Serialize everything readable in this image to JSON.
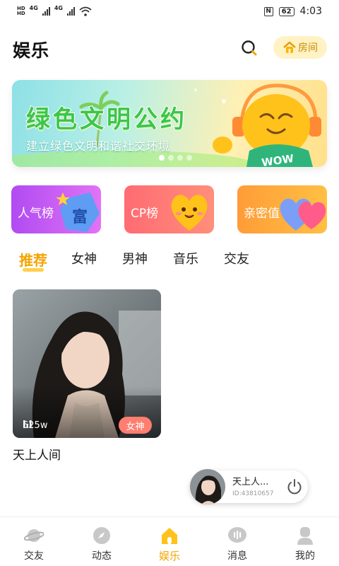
{
  "status_bar": {
    "network1": "4G",
    "network2": "4G",
    "nfc": "N",
    "battery": "62",
    "time": "4:03"
  },
  "header": {
    "title": "娱乐",
    "room_button": "房间"
  },
  "banner": {
    "title": "绿色文明公约",
    "subtitle": "建立绿色文明和谐社交环境",
    "art_text": "WOW",
    "active_dot": 1,
    "dot_count": 4
  },
  "categories": [
    {
      "label": "人气榜",
      "art_text": "富"
    },
    {
      "label": "CP榜"
    },
    {
      "label": "亲密值"
    }
  ],
  "tabs": [
    {
      "label": "推荐",
      "active": true
    },
    {
      "label": "女神"
    },
    {
      "label": "男神"
    },
    {
      "label": "音乐"
    },
    {
      "label": "交友"
    }
  ],
  "rooms": [
    {
      "name": "天上人间",
      "viewers": "625w",
      "tag": "女神"
    }
  ],
  "mini_player": {
    "name": "天上人...",
    "id": "ID:43810657"
  },
  "bottom_nav": [
    {
      "label": "交友"
    },
    {
      "label": "动态"
    },
    {
      "label": "娱乐",
      "active": true
    },
    {
      "label": "消息"
    },
    {
      "label": "我的"
    }
  ],
  "colors": {
    "accent": "#f5a300",
    "tag": "#ff7e70",
    "banner_title": "#3bc64a"
  }
}
